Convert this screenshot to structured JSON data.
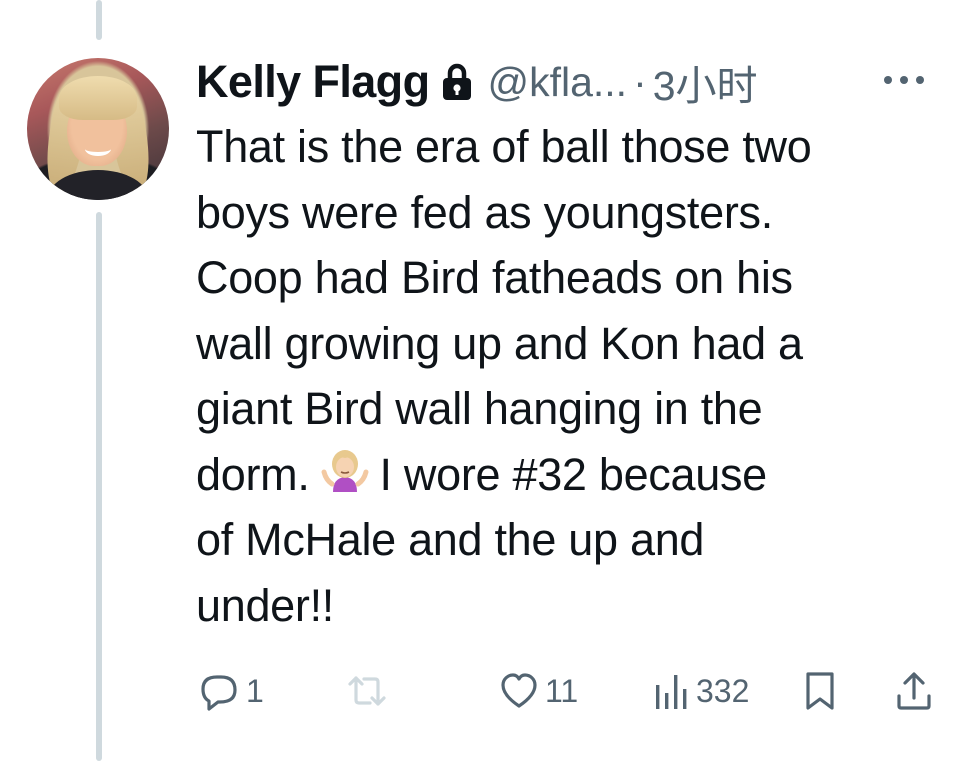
{
  "tweet": {
    "author": {
      "name": "Kelly Flagg",
      "handle": "@kfla...",
      "protected_icon": "lock-icon",
      "avatar": "profile-photo"
    },
    "separator": "·",
    "time": "3小时",
    "more_icon": "more-horizontal-icon",
    "text": {
      "line1": "That is the era of ball those two",
      "line2": "boys were fed as youngsters.",
      "line3": "Coop had Bird fatheads on his",
      "line4": "wall growing up and Kon had a",
      "line5": "giant Bird wall hanging in the",
      "line6a": "dorm.",
      "emoji": "person-shrugging-emoji",
      "line6b": "I wore #32 because",
      "line7": "of McHale and the up and",
      "line8": "under!!"
    },
    "actions": {
      "reply_count": "1",
      "retweet_count": "",
      "like_count": "11",
      "views_count": "332"
    }
  },
  "colors": {
    "text_primary": "#0f1419",
    "text_secondary": "#536471",
    "thread_line": "#cfd9de",
    "background": "#ffffff"
  }
}
